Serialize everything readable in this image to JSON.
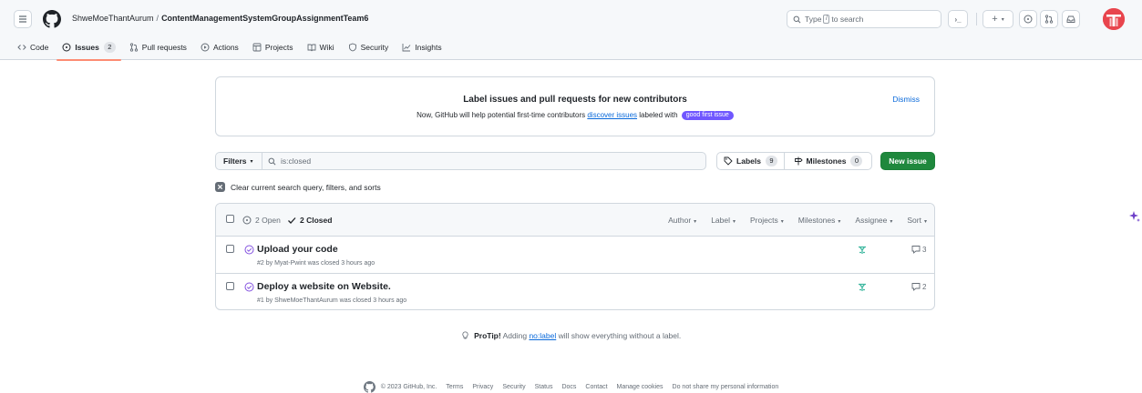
{
  "header": {
    "owner": "ShweMoeThantAurum",
    "separator": "/",
    "repo": "ContentManagementSystemGroupAssignmentTeam6",
    "search_prefix": "Type",
    "search_key": "/",
    "search_suffix": "to search",
    "terminal_glyph": "›_",
    "plus_glyph": "+",
    "caret_glyph": "▾"
  },
  "nav": {
    "code": "Code",
    "issues": "Issues",
    "issues_count": "2",
    "pull_requests": "Pull requests",
    "actions": "Actions",
    "projects": "Projects",
    "wiki": "Wiki",
    "security": "Security",
    "insights": "Insights"
  },
  "banner": {
    "title": "Label issues and pull requests for new contributors",
    "text_before": "Now, GitHub will help potential first-time contributors",
    "link": "discover issues",
    "text_after": "labeled with",
    "label": "good first issue",
    "dismiss": "Dismiss"
  },
  "filters": {
    "button": "Filters",
    "caret": "▾",
    "query": "is:closed",
    "labels": "Labels",
    "labels_count": "9",
    "milestones": "Milestones",
    "milestones_count": "0",
    "new_issue": "New issue",
    "clear": "Clear current search query, filters, and sorts"
  },
  "list": {
    "open": "2 Open",
    "closed": "2 Closed",
    "menus": {
      "author": "Author",
      "label": "Label",
      "projects": "Projects",
      "milestones": "Milestones",
      "assignee": "Assignee",
      "sort": "Sort",
      "caret": "▾"
    },
    "issues": [
      {
        "title": "Upload your code",
        "meta": "#2 by Myat-Pwint was closed 3 hours ago",
        "comments": "3"
      },
      {
        "title": "Deploy a website on Website.",
        "meta": "#1 by ShweMoeThantAurum was closed 3 hours ago",
        "comments": "2"
      }
    ]
  },
  "protip": {
    "strong": "ProTip!",
    "before": "Adding",
    "link": "no:label",
    "after": "will show everything without a label."
  },
  "footer": {
    "copyright": "© 2023 GitHub, Inc.",
    "links": [
      "Terms",
      "Privacy",
      "Security",
      "Status",
      "Docs",
      "Contact",
      "Manage cookies",
      "Do not share my personal information"
    ]
  },
  "colors": {
    "accent_green": "#1f883d",
    "closed_purple": "#8250df",
    "link_blue": "#0969da",
    "active_tab_underline": "#fd8c73",
    "label_purple": "#7057ff"
  }
}
